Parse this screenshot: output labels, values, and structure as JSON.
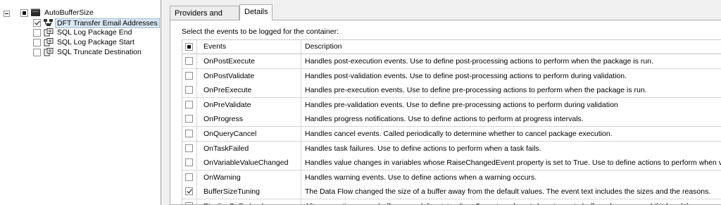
{
  "tree": {
    "root": {
      "label": "AutoBufferSize",
      "checked": "partial",
      "expanded": true
    },
    "children": [
      {
        "label": "DFT Transfer Email Addresses",
        "checked": true,
        "icon": "data-flow-task-icon",
        "selected": true
      },
      {
        "label": "SQL Log Package End",
        "checked": false,
        "icon": "execute-sql-task-icon",
        "selected": false
      },
      {
        "label": "SQL Log Package Start",
        "checked": false,
        "icon": "execute-sql-task-icon",
        "selected": false
      },
      {
        "label": "SQL Truncate Destination",
        "checked": false,
        "icon": "execute-sql-task-icon",
        "selected": false
      }
    ]
  },
  "tabs": [
    {
      "label": "Providers and Logs",
      "active": false
    },
    {
      "label": "Details",
      "active": true
    }
  ],
  "details": {
    "instruction": "Select the events to be logged for the container:",
    "columns": {
      "check": "",
      "events": "Events",
      "description": "Description"
    },
    "header_checked": "partial",
    "rows": [
      {
        "checked": false,
        "event": "OnPostExecute",
        "description": "Handles post-execution events. Use to define post-processing actions to perform when the package is run."
      },
      {
        "checked": false,
        "event": "OnPostValidate",
        "description": "Handles post-validation events. Use to define post-processing actions to perform during validation."
      },
      {
        "checked": false,
        "event": "OnPreExecute",
        "description": "Handles pre-execution events. Use to define pre-processing actions to perform when the package is run."
      },
      {
        "checked": false,
        "event": "OnPreValidate",
        "description": "Handles pre-validation events. Use to define pre-processing actions to perform during validation"
      },
      {
        "checked": false,
        "event": "OnProgress",
        "description": "Handles progress notifications. Use to define actions to perform at progress intervals."
      },
      {
        "checked": false,
        "event": "OnQueryCancel",
        "description": "Handles cancel events. Called periodically to determine whether to cancel package execution."
      },
      {
        "checked": false,
        "event": "OnTaskFailed",
        "description": "Handles task failures. Use to define actions to perform when a task fails."
      },
      {
        "checked": false,
        "event": "OnVariableValueChanged",
        "description": "Handles value changes in variables whose RaiseChangedEvent property is set to True. Use to define actions to perform when va"
      },
      {
        "checked": false,
        "event": "OnWarning",
        "description": "Handles warning events. Use to define actions when a warning occurs."
      },
      {
        "checked": true,
        "event": "BufferSizeTuning",
        "description": "The Data Flow changed the size of a buffer away from the default values. The event text includes the sizes and the reasons."
      },
      {
        "checked": false,
        "event": "PipelineBufferLeak",
        "description": "After execution, some buffers were left outstanding. Some transform is hanging onto buffer references and if it freed them we"
      }
    ]
  }
}
